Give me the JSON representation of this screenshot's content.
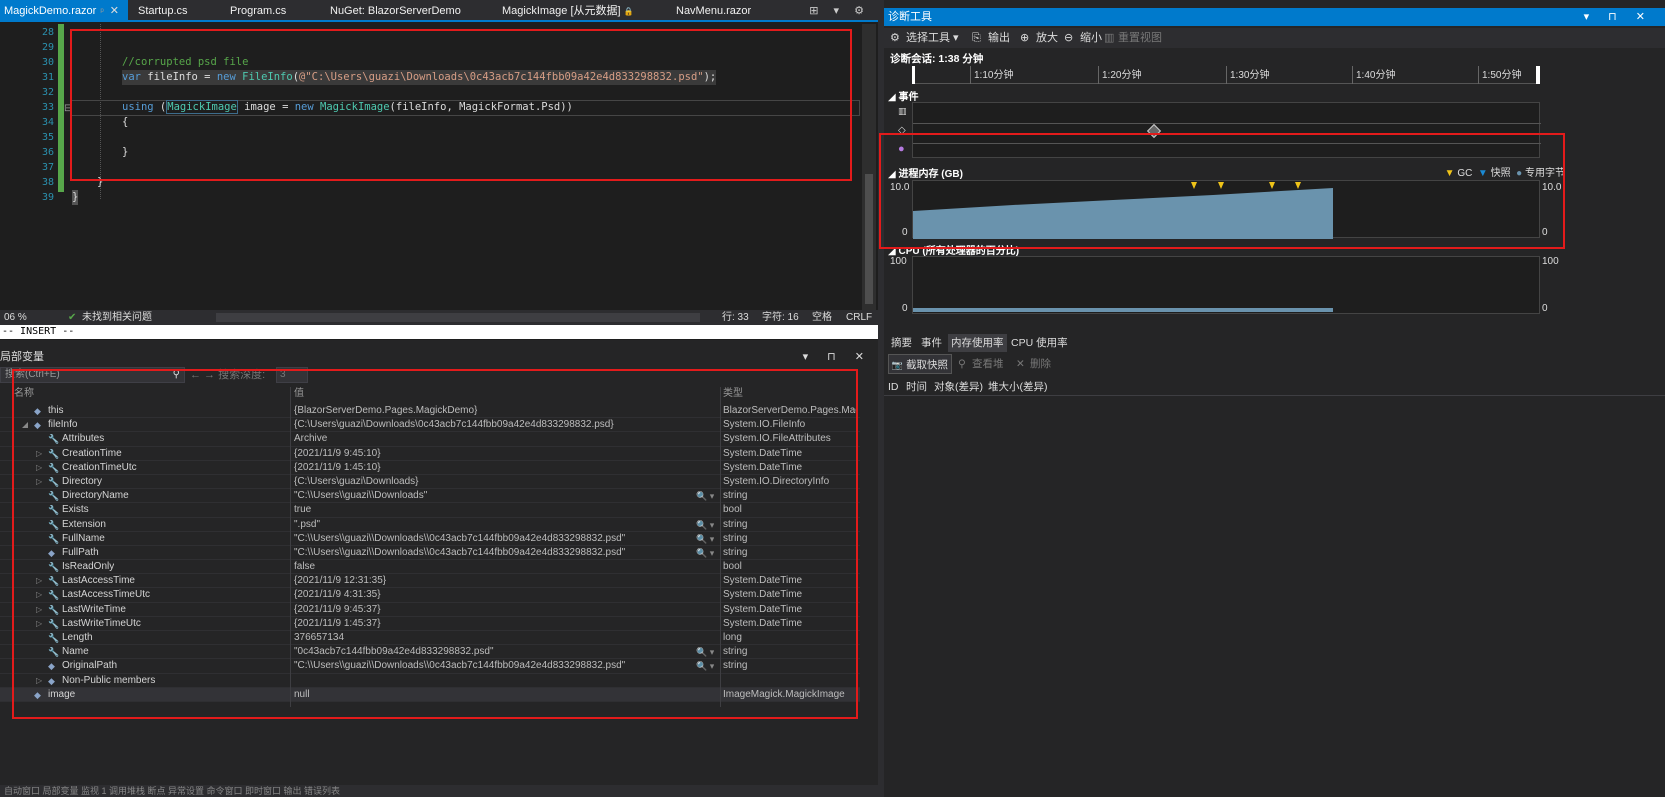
{
  "editor": {
    "tabs": [
      {
        "label": "MagickDemo.razor",
        "pin": "ᵖ",
        "close": "✕"
      },
      {
        "label": "Startup.cs"
      },
      {
        "label": "Program.cs"
      },
      {
        "label": "NuGet: BlazorServerDemo"
      },
      {
        "label": "MagickImage [从元数据]",
        "lock": "🔒"
      },
      {
        "label": "NavMenu.razor"
      }
    ],
    "tab_controls": "⊞ ▾ ⚙",
    "line_numbers": [
      "28",
      "29",
      "30",
      "31",
      "32",
      "33",
      "34",
      "35",
      "36",
      "37",
      "38",
      "39"
    ],
    "fold_mark": "⊟",
    "code": {
      "l30_comment": "//corrupted psd file",
      "l31_var": "var",
      "l31_name": " fileInfo = ",
      "l31_new": "new",
      "l31_type": " FileInfo",
      "l31_open": "(",
      "l31_string": "@\"C:\\Users\\guazi\\Downloads\\0c43acb7c144fbb09a42e4d833298832.psd\"",
      "l31_close": ");",
      "l33_using": "using",
      "l33_open": " (",
      "l33_type": "MagickImage",
      "l33_image": " image = ",
      "l33_new": "new",
      "l33_type2": " MagickImage",
      "l33_args": "(fileInfo, MagickFormat.Psd))",
      "l34": "{",
      "l36": "}",
      "l38": "}",
      "l39": "}"
    },
    "status": {
      "zoom": "06 %",
      "issues_icon": "✔",
      "issues": "未找到相关问题",
      "line": "行: 33",
      "char": "字符: 16",
      "space": "空格",
      "eol": "CRLF"
    },
    "insert_mode": "-- INSERT --"
  },
  "locals": {
    "title": "局部变量",
    "title_ctrls": "▾ ⊓ ✕",
    "search_placeholder": "搜索(Ctrl+E)",
    "search_icon": "⚲",
    "nav": "← →  搜索深度:",
    "depth": "3",
    "columns": {
      "name": "名称",
      "value": "值",
      "type": "类型"
    },
    "rows": [
      {
        "indent": 0,
        "exp": "",
        "icon": "◆",
        "name": "this",
        "value": "{BlazorServerDemo.Pages.MagickDemo}",
        "type": "BlazorServerDemo.Pages.Mag..."
      },
      {
        "indent": 0,
        "exp": "◢",
        "icon": "◆",
        "name": "fileInfo",
        "value": "{C:\\Users\\guazi\\Downloads\\0c43acb7c144fbb09a42e4d833298832.psd}",
        "type": "System.IO.FileInfo"
      },
      {
        "indent": 1,
        "exp": "",
        "icon": "🔧",
        "name": "Attributes",
        "value": "Archive",
        "type": "System.IO.FileAttributes"
      },
      {
        "indent": 1,
        "exp": "▷",
        "icon": "🔧",
        "name": "CreationTime",
        "value": "{2021/11/9 9:45:10}",
        "type": "System.DateTime"
      },
      {
        "indent": 1,
        "exp": "▷",
        "icon": "🔧",
        "name": "CreationTimeUtc",
        "value": "{2021/11/9 1:45:10}",
        "type": "System.DateTime"
      },
      {
        "indent": 1,
        "exp": "▷",
        "icon": "🔧",
        "name": "Directory",
        "value": "{C:\\Users\\guazi\\Downloads}",
        "type": "System.IO.DirectoryInfo"
      },
      {
        "indent": 1,
        "exp": "",
        "icon": "🔧",
        "name": "DirectoryName",
        "value": "\"C:\\\\Users\\\\guazi\\\\Downloads\"",
        "type": "string",
        "mag": "🔍 ▾"
      },
      {
        "indent": 1,
        "exp": "",
        "icon": "🔧",
        "name": "Exists",
        "value": "true",
        "type": "bool"
      },
      {
        "indent": 1,
        "exp": "",
        "icon": "🔧",
        "name": "Extension",
        "value": "\".psd\"",
        "type": "string",
        "mag": "🔍 ▾"
      },
      {
        "indent": 1,
        "exp": "",
        "icon": "🔧",
        "name": "FullName",
        "value": "\"C:\\\\Users\\\\guazi\\\\Downloads\\\\0c43acb7c144fbb09a42e4d833298832.psd\"",
        "type": "string",
        "mag": "🔍 ▾"
      },
      {
        "indent": 1,
        "exp": "",
        "icon": "◆",
        "name": "FullPath",
        "value": "\"C:\\\\Users\\\\guazi\\\\Downloads\\\\0c43acb7c144fbb09a42e4d833298832.psd\"",
        "type": "string",
        "mag": "🔍 ▾"
      },
      {
        "indent": 1,
        "exp": "",
        "icon": "🔧",
        "name": "IsReadOnly",
        "value": "false",
        "type": "bool"
      },
      {
        "indent": 1,
        "exp": "▷",
        "icon": "🔧",
        "name": "LastAccessTime",
        "value": "{2021/11/9 12:31:35}",
        "type": "System.DateTime"
      },
      {
        "indent": 1,
        "exp": "▷",
        "icon": "🔧",
        "name": "LastAccessTimeUtc",
        "value": "{2021/11/9 4:31:35}",
        "type": "System.DateTime"
      },
      {
        "indent": 1,
        "exp": "▷",
        "icon": "🔧",
        "name": "LastWriteTime",
        "value": "{2021/11/9 9:45:37}",
        "type": "System.DateTime"
      },
      {
        "indent": 1,
        "exp": "▷",
        "icon": "🔧",
        "name": "LastWriteTimeUtc",
        "value": "{2021/11/9 1:45:37}",
        "type": "System.DateTime"
      },
      {
        "indent": 1,
        "exp": "",
        "icon": "🔧",
        "name": "Length",
        "value": "376657134",
        "type": "long"
      },
      {
        "indent": 1,
        "exp": "",
        "icon": "🔧",
        "name": "Name",
        "value": "\"0c43acb7c144fbb09a42e4d833298832.psd\"",
        "type": "string",
        "mag": "🔍 ▾"
      },
      {
        "indent": 1,
        "exp": "",
        "icon": "◆",
        "name": "OriginalPath",
        "value": "\"C:\\\\Users\\\\guazi\\\\Downloads\\\\0c43acb7c144fbb09a42e4d833298832.psd\"",
        "type": "string",
        "mag": "🔍 ▾"
      },
      {
        "indent": 1,
        "exp": "▷",
        "icon": "◆",
        "name": "Non-Public members",
        "value": "",
        "type": ""
      },
      {
        "indent": 0,
        "exp": "",
        "icon": "◆",
        "name": "image",
        "value": "null",
        "type": "ImageMagick.MagickImage"
      }
    ],
    "bottom_tabs": "自动窗口  局部变量  监视 1  调用堆栈  断点  异常设置  命令窗口  即时窗口  输出  错误列表"
  },
  "diag": {
    "title": "诊断工具",
    "title_ctrls": "▾ ⊓ ✕",
    "toolbar": {
      "select_icon": "⚙",
      "select": "选择工具 ▾",
      "output_icon": "⎘",
      "output": "输出",
      "zoomin_icon": "⊕",
      "zoomin": "放大",
      "zoomout_icon": "⊖",
      "zoomout": "缩小",
      "reset_icon": "▥",
      "reset": "重置视图"
    },
    "session": "诊断会话: 1:38 分钟",
    "ruler": [
      "1:10分钟",
      "1:20分钟",
      "1:30分钟",
      "1:40分钟",
      "1:50分钟"
    ],
    "events_label": "◢ 事件",
    "memory_label": "◢ 进程内存 (GB)",
    "legend": {
      "gc_icon": "▼",
      "gc": "GC",
      "snap_icon": "▼",
      "snap": "快照",
      "private_icon": "●",
      "private": "专用字节"
    },
    "memory_max": "10.0",
    "memory_min": "0",
    "cpu_label": "◢ CPU (所有处理器的百分比)",
    "cpu_max": "100",
    "cpu_min": "0",
    "colors": {
      "memory_fill": "#6a93ad",
      "gc_marker": "#f0c419",
      "snap_marker": "#1b8ad3",
      "accent": "#007acc"
    },
    "tabs": [
      "摘要",
      "事件",
      "内存使用率",
      "CPU 使用率"
    ],
    "snap_bar": {
      "take_icon": "📷",
      "take": "截取快照",
      "heap_icon": "⚲",
      "heap": "查看堆",
      "del_icon": "✕",
      "del": "删除"
    },
    "snap_cols": [
      "ID",
      "时间",
      "对象(差异)",
      "堆大小(差异)"
    ]
  }
}
